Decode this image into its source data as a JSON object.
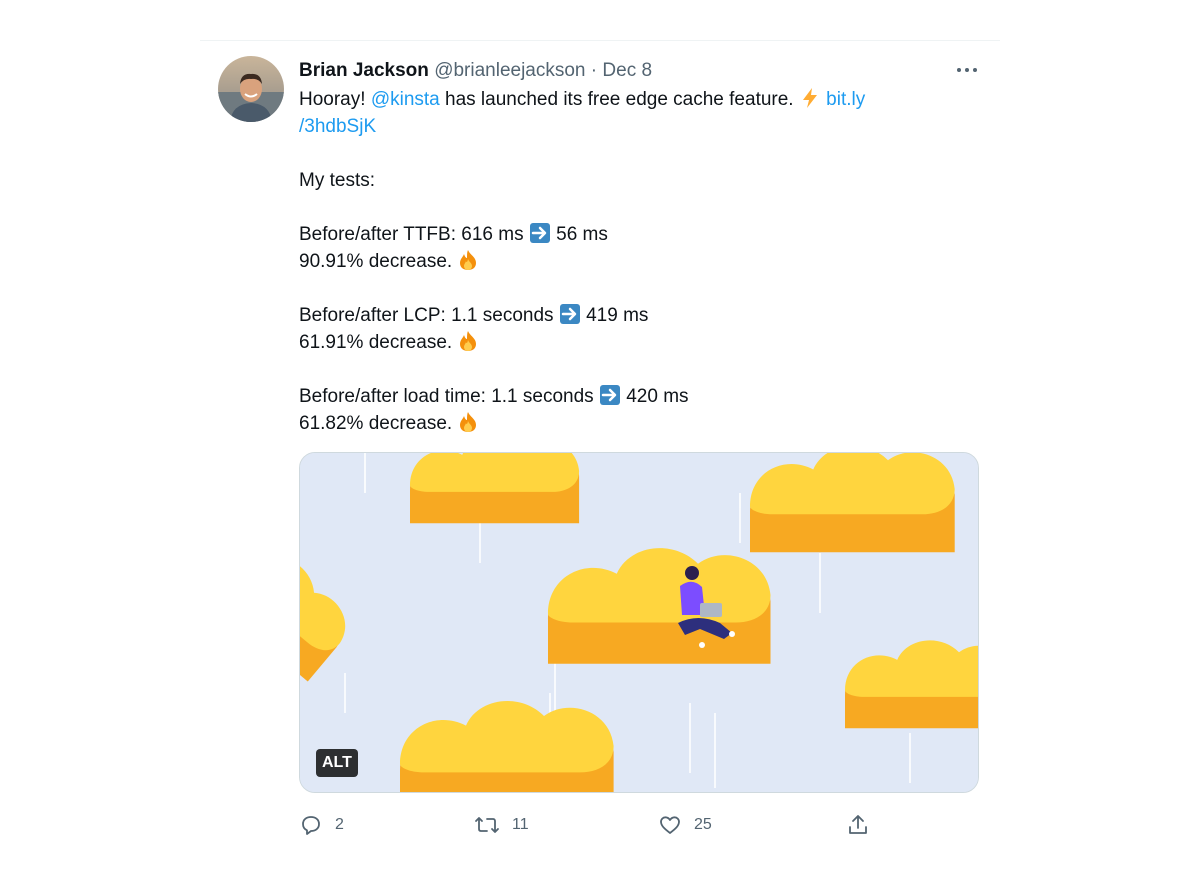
{
  "tweet": {
    "author_name": "Brian Jackson",
    "author_handle": "@brianleejackson",
    "separator": "·",
    "date": "Dec 8",
    "line1_text": "Hooray! ",
    "mention": "@kinsta",
    "line1_rest": " has launched its free edge cache feature. ",
    "link_part1": "bit.ly",
    "link_part2": "/3hdbSjK",
    "tests_heading": "My tests:",
    "ttfb_before": "Before/after TTFB: 616 ms",
    "ttfb_after": "56 ms",
    "ttfb_decrease": "90.91% decrease.",
    "lcp_before": "Before/after LCP: 1.1 seconds",
    "lcp_after": "419 ms",
    "lcp_decrease": "61.91% decrease.",
    "load_before": "Before/after load time: 1.1 seconds",
    "load_after": "420 ms",
    "load_decrease": "61.82% decrease."
  },
  "media": {
    "alt_badge": "ALT"
  },
  "actions": {
    "reply_count": "2",
    "retweet_count": "11",
    "like_count": "25"
  },
  "icons": {
    "more": "more-dots-icon",
    "lightning": "lightning-emoji",
    "arrow": "right-arrow-emoji",
    "fire": "fire-emoji",
    "reply": "reply-icon",
    "retweet": "retweet-icon",
    "like": "heart-icon",
    "share": "share-icon"
  },
  "colors": {
    "link": "#1d9bf0",
    "secondary_text": "#536471",
    "cloud_top": "#ffd53e",
    "cloud_side": "#f7a922",
    "media_bg": "#e0e8f6"
  }
}
